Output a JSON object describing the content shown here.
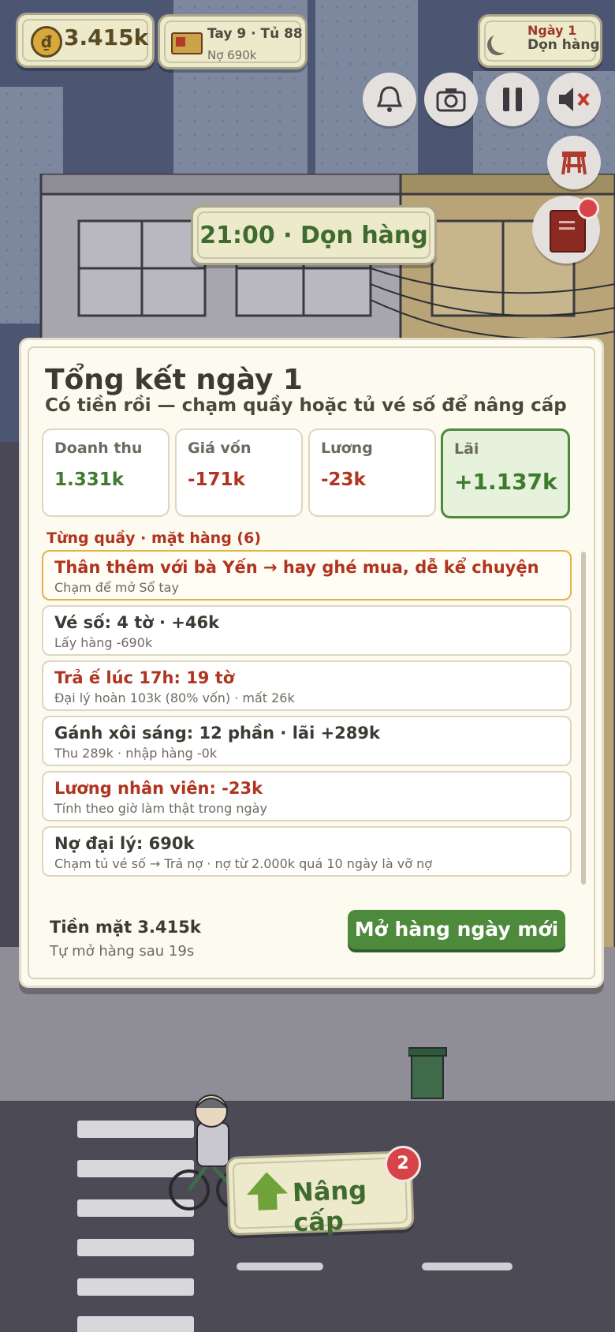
{
  "hud": {
    "money": "3.415k",
    "ticket_line1": "Tay 9 · Tủ 88",
    "ticket_line2": "Nợ 690k",
    "day_line1": "Ngày 1",
    "day_line2": "Dọn hàng"
  },
  "icons": {
    "bell": "bell-icon",
    "camera": "camera-icon",
    "pause": "pause-icon",
    "mute": "speaker-muted-icon",
    "stool": "stool-icon",
    "notebook": "notebook-icon"
  },
  "time_banner": "21:00 · Dọn hàng",
  "summary": {
    "title": "Tổng kết ngày 1",
    "subtitle": "Có tiền rồi — chạm quầy hoặc tủ vé số để nâng cấp",
    "stats": [
      {
        "label": "Doanh thu",
        "value": "1.331k"
      },
      {
        "label": "Giá vốn",
        "value": "-171k"
      },
      {
        "label": "Lương",
        "value": "-23k"
      },
      {
        "label": "Lãi",
        "value": "+1.137k"
      }
    ],
    "section_title": "Từng quầy · mặt hàng (6)",
    "items": [
      {
        "title": "Thân thêm với bà Yến → hay ghé mua, dễ kể chuyện",
        "sub": "Chạm để mở Sổ tay"
      },
      {
        "title": "Vé số: 4 tờ · +46k",
        "sub": "Lấy hàng -690k"
      },
      {
        "title": "Trả ế lúc 17h: 19 tờ",
        "sub": "Đại lý hoàn 103k (80% vốn) · mất 26k"
      },
      {
        "title": "Gánh xôi sáng: 12 phần · lãi +289k",
        "sub": "Thu 289k · nhập hàng -0k"
      },
      {
        "title": "Lương nhân viên: -23k",
        "sub": "Tính theo giờ làm thật trong ngày"
      },
      {
        "title": "Nợ đại lý: 690k",
        "sub": "Chạm tủ vé số → Trả nợ · nợ từ 2.000k quá 10 ngày là vỡ nợ"
      }
    ],
    "cash": "Tiền mặt 3.415k",
    "auto_open": "Tự mở hàng sau 19s",
    "new_day_button": "Mở hàng ngày mới"
  },
  "upgrade": {
    "label": "Nâng cấp",
    "badge": "2"
  },
  "colors": {
    "positive": "#3f7a2f",
    "negative": "#b0341f",
    "accent_green": "#4e8a3c",
    "alert_red": "#d8434a"
  }
}
